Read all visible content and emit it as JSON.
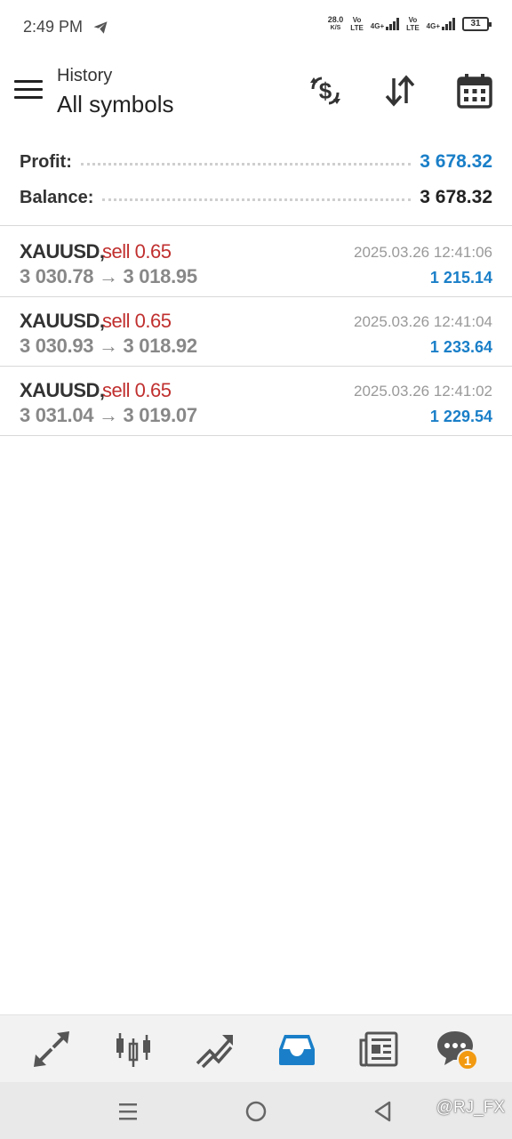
{
  "status_bar": {
    "time": "2:49 PM",
    "speed_value": "28.0",
    "speed_unit": "K/S",
    "sim1_label": "Vo\nLTE",
    "sim1_net": "4G+",
    "sim2_label": "Vo\nLTE",
    "sim2_net": "4G+",
    "battery": "31"
  },
  "header": {
    "section": "History",
    "filter": "All symbols"
  },
  "summary": {
    "profit_label": "Profit:",
    "profit_value": "3 678.32",
    "balance_label": "Balance:",
    "balance_value": "3 678.32"
  },
  "deals": [
    {
      "symbol": "XAUUSD,",
      "type": "sell 0.65",
      "prices": "3 030.78 → 3 018.95",
      "time": "2025.03.26 12:41:06",
      "profit": "1 215.14"
    },
    {
      "symbol": "XAUUSD,",
      "type": "sell 0.65",
      "prices": "3 030.93 → 3 018.92",
      "time": "2025.03.26 12:41:04",
      "profit": "1 233.64"
    },
    {
      "symbol": "XAUUSD,",
      "type": "sell 0.65",
      "prices": "3 031.04 → 3 019.07",
      "time": "2025.03.26 12:41:02",
      "profit": "1 229.54"
    }
  ],
  "bottom_nav": {
    "items": [
      "quotes-icon",
      "chart-icon",
      "trade-icon",
      "history-icon",
      "news-icon",
      "chat-icon"
    ],
    "active": "history-icon",
    "chat_badge": "1"
  },
  "watermark": "@RJ_FX",
  "colors": {
    "accent": "#1a7fc8",
    "sell": "#c0302f",
    "badge": "#f29a12"
  }
}
